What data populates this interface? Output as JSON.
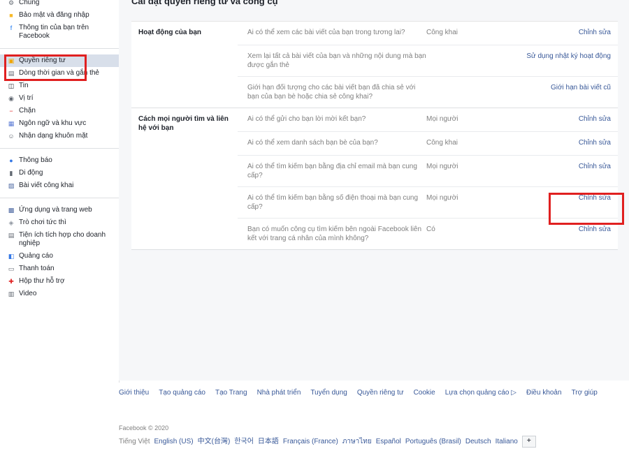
{
  "colors": {
    "accent": "#385898",
    "highlight": "#e02020",
    "active_bg": "#d8dfea"
  },
  "sidebar": {
    "groups": [
      {
        "items": [
          {
            "label": "Chung",
            "icon": "gear-icon"
          },
          {
            "label": "Bảo mật và đăng nhập",
            "icon": "shield-icon"
          },
          {
            "label": "Thông tin của bạn trên Facebook",
            "icon": "facebook-icon"
          }
        ]
      },
      {
        "items": [
          {
            "label": "Quyền riêng tư",
            "icon": "lock-icon",
            "active": true
          },
          {
            "label": "Dòng thời gian và gắn thẻ",
            "icon": "timeline-icon"
          },
          {
            "label": "Tin",
            "icon": "book-icon"
          },
          {
            "label": "Vị trí",
            "icon": "location-icon"
          },
          {
            "label": "Chặn",
            "icon": "block-icon"
          },
          {
            "label": "Ngôn ngữ và khu vực",
            "icon": "language-icon"
          },
          {
            "label": "Nhận dạng khuôn mặt",
            "icon": "face-icon"
          }
        ]
      },
      {
        "items": [
          {
            "label": "Thông báo",
            "icon": "globe-icon"
          },
          {
            "label": "Di động",
            "icon": "mobile-icon"
          },
          {
            "label": "Bài viết công khai",
            "icon": "rss-icon"
          }
        ]
      },
      {
        "items": [
          {
            "label": "Ứng dụng và trang web",
            "icon": "apps-icon"
          },
          {
            "label": "Trò chơi tức thì",
            "icon": "game-icon"
          },
          {
            "label": "Tiện ích tích hợp cho doanh nghiệp",
            "icon": "business-icon"
          },
          {
            "label": "Quảng cáo",
            "icon": "ads-icon"
          },
          {
            "label": "Thanh toán",
            "icon": "payment-icon"
          },
          {
            "label": "Hộp thư hỗ trợ",
            "icon": "support-icon"
          },
          {
            "label": "Video",
            "icon": "video-icon"
          }
        ]
      }
    ]
  },
  "main": {
    "title": "Cài đặt quyền riêng tư và công cụ",
    "sections": [
      {
        "title": "Hoạt động của bạn",
        "rows": [
          {
            "question": "Ai có thể xem các bài viết của bạn trong tương lai?",
            "value": "Công khai",
            "action": "Chỉnh sửa"
          },
          {
            "question": "Xem lại tất cả bài viết của bạn và những nội dung mà bạn được gắn thẻ",
            "value": "",
            "action": "Sử dụng nhật ký hoạt động"
          },
          {
            "question": "Giới hạn đối tượng cho các bài viết bạn đã chia sẻ với bạn của bạn bè hoặc chia sẻ công khai?",
            "value": "",
            "action": "Giới hạn bài viết cũ"
          }
        ]
      },
      {
        "title": "Cách mọi người tìm và liên hệ với bạn",
        "rows": [
          {
            "question": "Ai có thể gửi cho bạn lời mời kết bạn?",
            "value": "Mọi người",
            "action": "Chỉnh sửa"
          },
          {
            "question": "Ai có thể xem danh sách bạn bè của bạn?",
            "value": "Công khai",
            "action": "Chỉnh sửa"
          },
          {
            "question": "Ai có thể tìm kiếm bạn bằng địa chỉ email mà bạn cung cấp?",
            "value": "Mọi người",
            "action": "Chỉnh sửa"
          },
          {
            "question": "Ai có thể tìm kiếm bạn bằng số điện thoại mà bạn cung cấp?",
            "value": "Mọi người",
            "action": "Chỉnh sửa",
            "highlight": true
          },
          {
            "question": "Bạn có muốn công cụ tìm kiếm bên ngoài Facebook liên kết với trang cá nhân của mình không?",
            "value": "Có",
            "action": "Chỉnh sửa"
          }
        ]
      }
    ]
  },
  "footer": {
    "links": [
      "Giới thiệu",
      "Tạo quảng cáo",
      "Tạo Trang",
      "Nhà phát triển",
      "Tuyển dụng",
      "Quyền riêng tư",
      "Cookie",
      "Lựa chọn quảng cáo ▷",
      "Điều khoản",
      "Trợ giúp"
    ],
    "copyright": "Facebook © 2020",
    "current_language": "Tiếng Việt",
    "languages": [
      "English (US)",
      "中文(台灣)",
      "한국어",
      "日本語",
      "Français (France)",
      "ภาษาไทย",
      "Español",
      "Português (Brasil)",
      "Deutsch",
      "Italiano"
    ],
    "add_language": "+"
  }
}
